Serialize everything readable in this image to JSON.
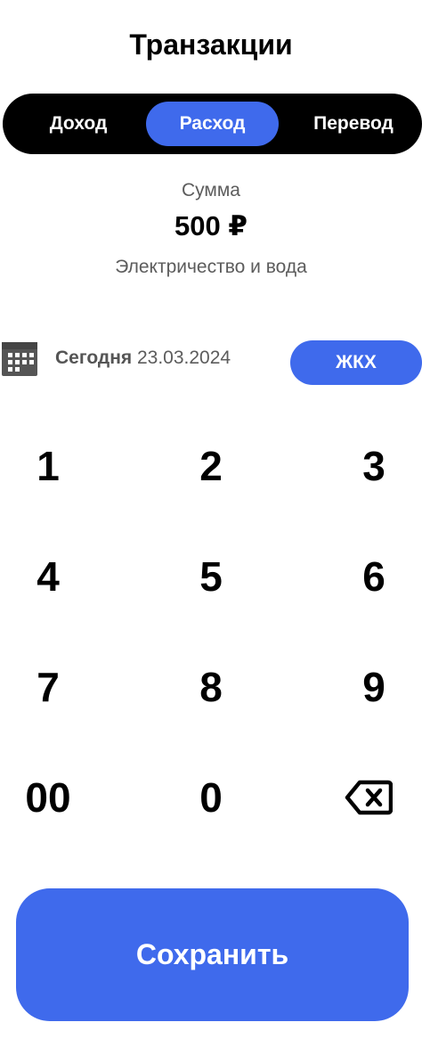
{
  "header": {
    "title": "Транзакции"
  },
  "tabs": [
    {
      "label": "Доход"
    },
    {
      "label": "Расход",
      "active": true
    },
    {
      "label": "Перевод"
    }
  ],
  "amount": {
    "label": "Сумма",
    "value": "500 ₽"
  },
  "description": "Электричество и вода",
  "date": {
    "today_label": "Сегодня",
    "value": "23.03.2024",
    "icon": "calendar-icon"
  },
  "category": {
    "label": "ЖКХ"
  },
  "keypad": {
    "keys": [
      "1",
      "2",
      "3",
      "4",
      "5",
      "6",
      "7",
      "8",
      "9",
      "00",
      "0"
    ],
    "backspace_icon": "backspace-icon"
  },
  "save_button": {
    "label": "Сохранить"
  },
  "colors": {
    "accent": "#3f6aec",
    "segmented_bg": "#000000",
    "muted_text": "#5c5c5c"
  }
}
